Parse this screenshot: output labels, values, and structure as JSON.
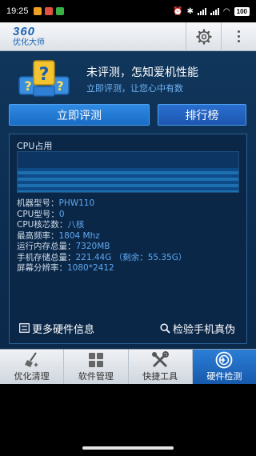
{
  "status": {
    "time": "19:25",
    "battery": "100"
  },
  "app": {
    "logo": "360",
    "subtitle": "优化大师"
  },
  "hero": {
    "title": "未评测，怎知爱机性能",
    "subtitle": "立即评测，让您心中有数"
  },
  "buttons": {
    "evaluate": "立即评测",
    "ranking": "排行榜"
  },
  "panel": {
    "cpu_label": "CPU占用",
    "specs": [
      {
        "label": "机器型号：",
        "value": "PHW110"
      },
      {
        "label": "CPU型号：",
        "value": "0"
      },
      {
        "label": "CPU核芯数：",
        "value": "八核"
      },
      {
        "label": "最高频率：",
        "value": "1804 Mhz"
      },
      {
        "label": "运行内存总量：",
        "value": "7320MB"
      },
      {
        "label": "手机存储总量：",
        "value": "221.44G （剩余：55.35G）"
      },
      {
        "label": "屏幕分辨率：",
        "value": "1080*2412"
      }
    ],
    "link_more": "更多硬件信息",
    "link_check": "检验手机真伪"
  },
  "nav": {
    "items": [
      {
        "label": "优化清理",
        "icon": "broom-icon"
      },
      {
        "label": "软件管理",
        "icon": "apps-grid-icon"
      },
      {
        "label": "快捷工具",
        "icon": "tools-icon"
      },
      {
        "label": "硬件检测",
        "icon": "hardware-detect-icon"
      }
    ],
    "active_index": 3
  },
  "colors": {
    "accent": "#1f6fc8",
    "link": "#5fa8ee",
    "background": "#0d2f53"
  }
}
